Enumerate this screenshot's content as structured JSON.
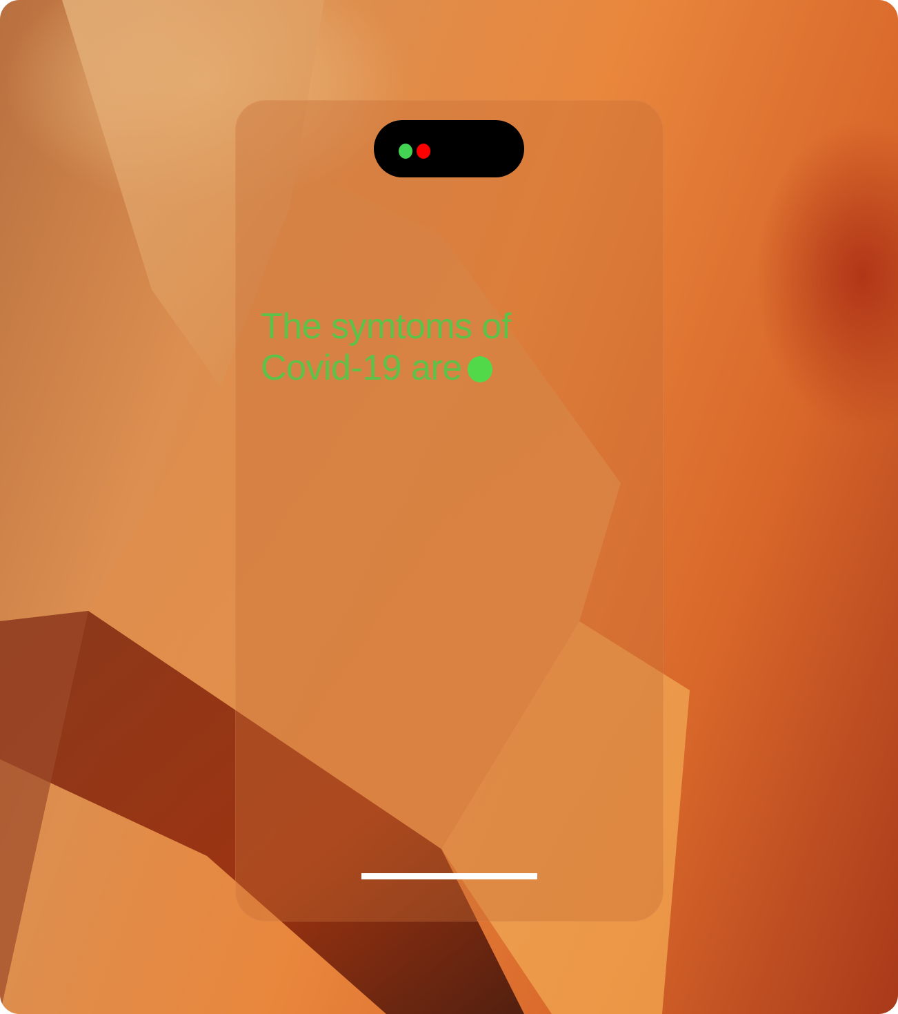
{
  "screen": {
    "message": {
      "line1": "The symtoms of",
      "line2": "Covid-19 are",
      "text_color": "#5cc24a"
    },
    "dynamic_island": {
      "indicators": [
        {
          "name": "green-indicator",
          "color": "#44d454"
        },
        {
          "name": "red-indicator",
          "color": "#ff0000"
        }
      ]
    },
    "typing_indicator_color": "#52d94a",
    "home_indicator_color": "#ffffff"
  },
  "wallpaper": {
    "colors": [
      "#e3b27a",
      "#e9873d",
      "#a8391a",
      "#7a1e0c"
    ]
  }
}
